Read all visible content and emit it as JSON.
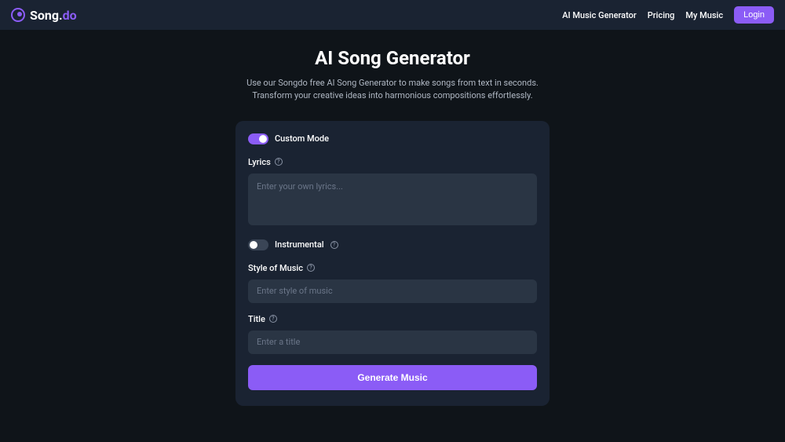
{
  "header": {
    "logo": {
      "text_prefix": "Song.",
      "text_suffix": "do"
    },
    "nav": {
      "ai_music_generator": "AI Music Generator",
      "pricing": "Pricing",
      "my_music": "My Music",
      "login": "Login"
    }
  },
  "page": {
    "title": "AI Song Generator",
    "subtitle": "Use our Songdo free AI Song Generator to make songs from text in seconds. Transform your creative ideas into harmonious compositions effortlessly."
  },
  "form": {
    "custom_mode": {
      "label": "Custom Mode",
      "enabled": true
    },
    "lyrics": {
      "label": "Lyrics",
      "placeholder": "Enter your own lyrics..."
    },
    "instrumental": {
      "label": "Instrumental",
      "enabled": false
    },
    "style": {
      "label": "Style of Music",
      "placeholder": "Enter style of music"
    },
    "title_field": {
      "label": "Title",
      "placeholder": "Enter a title"
    },
    "generate_button": "Generate Music"
  }
}
